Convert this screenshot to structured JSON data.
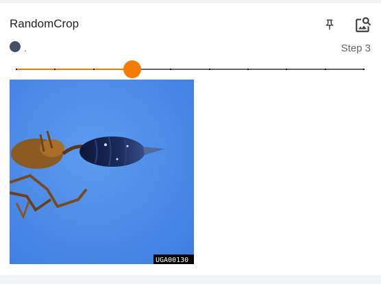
{
  "card": {
    "title": "RandomCrop",
    "run_label": ".",
    "step_label": "Step 3",
    "run_color": "#425066"
  },
  "icons": {
    "pin": "pin-icon",
    "image_search": "image-search-icon"
  },
  "slider": {
    "steps": 10,
    "current_index": 3,
    "accent": "#f57c00"
  },
  "image": {
    "watermark": "UGA00130",
    "description_hint": "insect-abdomen-photo"
  }
}
